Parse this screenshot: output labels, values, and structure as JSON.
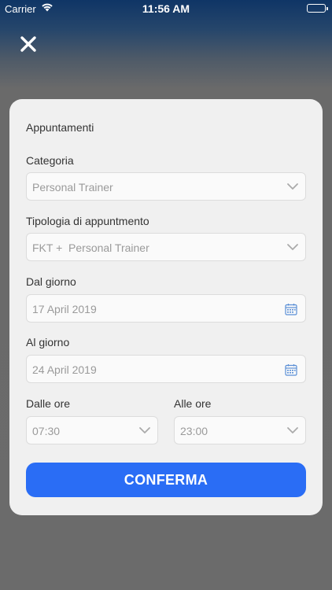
{
  "status_bar": {
    "carrier": "Carrier",
    "time": "11:56 AM"
  },
  "modal": {
    "title": "Appuntamenti",
    "category": {
      "label": "Categoria",
      "value": "Personal Trainer"
    },
    "appointment_type": {
      "label": "Tipologia di appuntmento",
      "value": "FKT +  Personal Trainer"
    },
    "from_date": {
      "label": "Dal giorno",
      "value": "17 April 2019"
    },
    "to_date": {
      "label": "Al giorno",
      "value": "24 April 2019"
    },
    "from_time": {
      "label": "Dalle ore",
      "value": "07:30"
    },
    "to_time": {
      "label": "Alle ore",
      "value": "23:00"
    },
    "confirm_label": "CONFERMA"
  },
  "colors": {
    "accent": "#2a6df5",
    "card_bg": "#f0f0f0",
    "field_bg": "#fafafa",
    "overlay": "#6b6b6b"
  },
  "icons": {
    "close": "close-icon",
    "chevron": "chevron-down-icon",
    "calendar": "calendar-icon"
  }
}
